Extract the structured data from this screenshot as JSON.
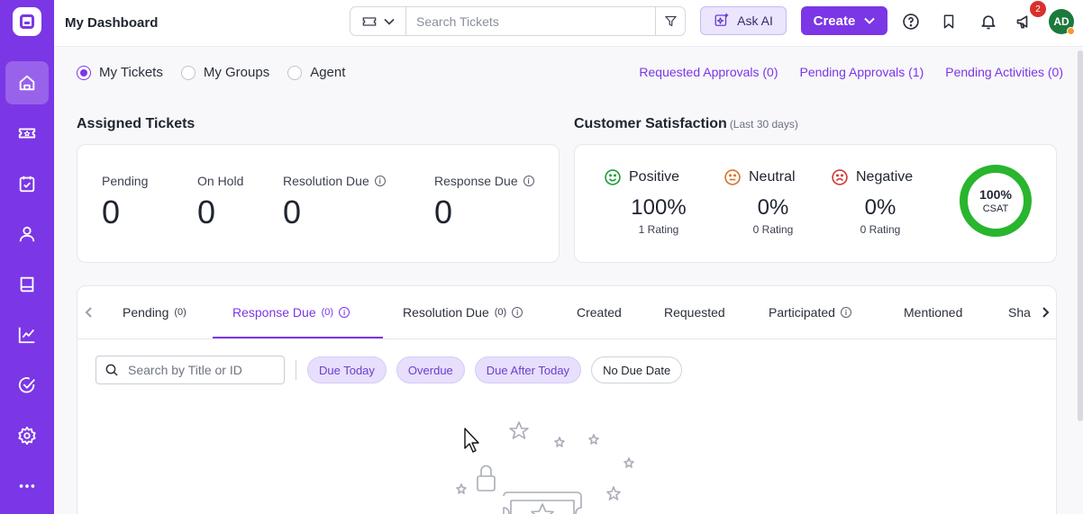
{
  "header": {
    "title": "My Dashboard",
    "search_placeholder": "Search Tickets",
    "ask_ai_label": "Ask AI",
    "create_label": "Create",
    "notification_count": "2",
    "avatar_initials": "AD"
  },
  "sidebar": {
    "items": [
      {
        "name": "home",
        "active": true
      },
      {
        "name": "tickets"
      },
      {
        "name": "tasks"
      },
      {
        "name": "contacts"
      },
      {
        "name": "knowledge-base"
      },
      {
        "name": "reports"
      },
      {
        "name": "approvals"
      },
      {
        "name": "settings"
      },
      {
        "name": "more"
      }
    ]
  },
  "view_options": {
    "selected": "My Tickets",
    "options": [
      "My Tickets",
      "My Groups",
      "Agent"
    ]
  },
  "quick_links": [
    "Requested Approvals (0)",
    "Pending Approvals (1)",
    "Pending Activities (0)"
  ],
  "assigned_tickets": {
    "title": "Assigned Tickets",
    "stats": [
      {
        "label": "Pending",
        "value": "0"
      },
      {
        "label": "On Hold",
        "value": "0"
      },
      {
        "label": "Resolution Due",
        "value": "0"
      },
      {
        "label": "Response Due",
        "value": "0"
      }
    ]
  },
  "customer_satisfaction": {
    "title": "Customer Satisfaction",
    "subtitle": "(Last 30 days)",
    "columns": [
      {
        "label": "Positive",
        "percent": "100%",
        "rating": "1 Rating",
        "color": "#1f9d3a"
      },
      {
        "label": "Neutral",
        "percent": "0%",
        "rating": "0 Rating",
        "color": "#d9742b"
      },
      {
        "label": "Negative",
        "percent": "0%",
        "rating": "0 Rating",
        "color": "#d23a3a"
      }
    ],
    "csat_value": "100%",
    "csat_label": "CSAT"
  },
  "tabs": {
    "items": [
      {
        "label": "Pending",
        "count": "(0)"
      },
      {
        "label": "Response Due",
        "count": "(0)"
      },
      {
        "label": "Resolution Due",
        "count": "(0)"
      },
      {
        "label": "Created"
      },
      {
        "label": "Requested"
      },
      {
        "label": "Participated"
      },
      {
        "label": "Mentioned"
      },
      {
        "label": "Sha"
      }
    ],
    "active": "Response Due"
  },
  "filters": {
    "search_placeholder": "Search by Title or ID",
    "chips": [
      "Due Today",
      "Overdue",
      "Due After Today",
      "No Due Date"
    ]
  },
  "colors": {
    "brand": "#7b36e6",
    "csat_ring": "#29b52d",
    "badge": "#d9302c",
    "avatar": "#1c7a3c"
  }
}
